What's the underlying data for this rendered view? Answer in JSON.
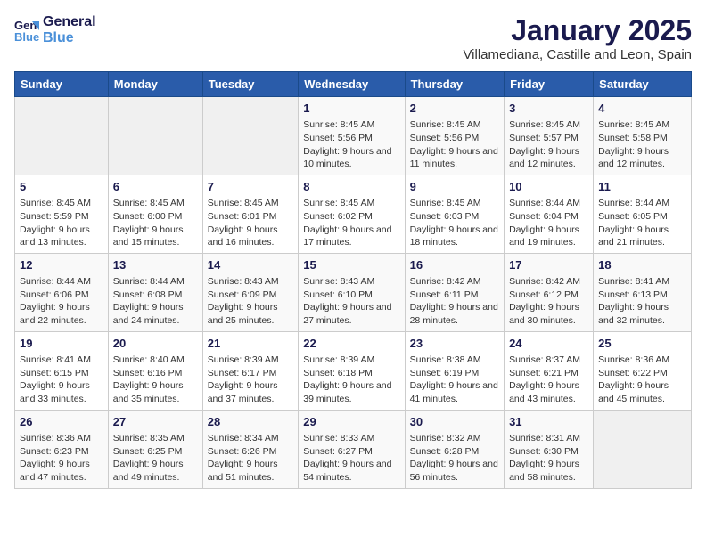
{
  "logo": {
    "line1": "General",
    "line2": "Blue"
  },
  "title": "January 2025",
  "subtitle": "Villamediana, Castille and Leon, Spain",
  "days_of_week": [
    "Sunday",
    "Monday",
    "Tuesday",
    "Wednesday",
    "Thursday",
    "Friday",
    "Saturday"
  ],
  "weeks": [
    [
      {
        "day": "",
        "info": ""
      },
      {
        "day": "",
        "info": ""
      },
      {
        "day": "",
        "info": ""
      },
      {
        "day": "1",
        "info": "Sunrise: 8:45 AM\nSunset: 5:56 PM\nDaylight: 9 hours and 10 minutes."
      },
      {
        "day": "2",
        "info": "Sunrise: 8:45 AM\nSunset: 5:56 PM\nDaylight: 9 hours and 11 minutes."
      },
      {
        "day": "3",
        "info": "Sunrise: 8:45 AM\nSunset: 5:57 PM\nDaylight: 9 hours and 12 minutes."
      },
      {
        "day": "4",
        "info": "Sunrise: 8:45 AM\nSunset: 5:58 PM\nDaylight: 9 hours and 12 minutes."
      }
    ],
    [
      {
        "day": "5",
        "info": "Sunrise: 8:45 AM\nSunset: 5:59 PM\nDaylight: 9 hours and 13 minutes."
      },
      {
        "day": "6",
        "info": "Sunrise: 8:45 AM\nSunset: 6:00 PM\nDaylight: 9 hours and 15 minutes."
      },
      {
        "day": "7",
        "info": "Sunrise: 8:45 AM\nSunset: 6:01 PM\nDaylight: 9 hours and 16 minutes."
      },
      {
        "day": "8",
        "info": "Sunrise: 8:45 AM\nSunset: 6:02 PM\nDaylight: 9 hours and 17 minutes."
      },
      {
        "day": "9",
        "info": "Sunrise: 8:45 AM\nSunset: 6:03 PM\nDaylight: 9 hours and 18 minutes."
      },
      {
        "day": "10",
        "info": "Sunrise: 8:44 AM\nSunset: 6:04 PM\nDaylight: 9 hours and 19 minutes."
      },
      {
        "day": "11",
        "info": "Sunrise: 8:44 AM\nSunset: 6:05 PM\nDaylight: 9 hours and 21 minutes."
      }
    ],
    [
      {
        "day": "12",
        "info": "Sunrise: 8:44 AM\nSunset: 6:06 PM\nDaylight: 9 hours and 22 minutes."
      },
      {
        "day": "13",
        "info": "Sunrise: 8:44 AM\nSunset: 6:08 PM\nDaylight: 9 hours and 24 minutes."
      },
      {
        "day": "14",
        "info": "Sunrise: 8:43 AM\nSunset: 6:09 PM\nDaylight: 9 hours and 25 minutes."
      },
      {
        "day": "15",
        "info": "Sunrise: 8:43 AM\nSunset: 6:10 PM\nDaylight: 9 hours and 27 minutes."
      },
      {
        "day": "16",
        "info": "Sunrise: 8:42 AM\nSunset: 6:11 PM\nDaylight: 9 hours and 28 minutes."
      },
      {
        "day": "17",
        "info": "Sunrise: 8:42 AM\nSunset: 6:12 PM\nDaylight: 9 hours and 30 minutes."
      },
      {
        "day": "18",
        "info": "Sunrise: 8:41 AM\nSunset: 6:13 PM\nDaylight: 9 hours and 32 minutes."
      }
    ],
    [
      {
        "day": "19",
        "info": "Sunrise: 8:41 AM\nSunset: 6:15 PM\nDaylight: 9 hours and 33 minutes."
      },
      {
        "day": "20",
        "info": "Sunrise: 8:40 AM\nSunset: 6:16 PM\nDaylight: 9 hours and 35 minutes."
      },
      {
        "day": "21",
        "info": "Sunrise: 8:39 AM\nSunset: 6:17 PM\nDaylight: 9 hours and 37 minutes."
      },
      {
        "day": "22",
        "info": "Sunrise: 8:39 AM\nSunset: 6:18 PM\nDaylight: 9 hours and 39 minutes."
      },
      {
        "day": "23",
        "info": "Sunrise: 8:38 AM\nSunset: 6:19 PM\nDaylight: 9 hours and 41 minutes."
      },
      {
        "day": "24",
        "info": "Sunrise: 8:37 AM\nSunset: 6:21 PM\nDaylight: 9 hours and 43 minutes."
      },
      {
        "day": "25",
        "info": "Sunrise: 8:36 AM\nSunset: 6:22 PM\nDaylight: 9 hours and 45 minutes."
      }
    ],
    [
      {
        "day": "26",
        "info": "Sunrise: 8:36 AM\nSunset: 6:23 PM\nDaylight: 9 hours and 47 minutes."
      },
      {
        "day": "27",
        "info": "Sunrise: 8:35 AM\nSunset: 6:25 PM\nDaylight: 9 hours and 49 minutes."
      },
      {
        "day": "28",
        "info": "Sunrise: 8:34 AM\nSunset: 6:26 PM\nDaylight: 9 hours and 51 minutes."
      },
      {
        "day": "29",
        "info": "Sunrise: 8:33 AM\nSunset: 6:27 PM\nDaylight: 9 hours and 54 minutes."
      },
      {
        "day": "30",
        "info": "Sunrise: 8:32 AM\nSunset: 6:28 PM\nDaylight: 9 hours and 56 minutes."
      },
      {
        "day": "31",
        "info": "Sunrise: 8:31 AM\nSunset: 6:30 PM\nDaylight: 9 hours and 58 minutes."
      },
      {
        "day": "",
        "info": ""
      }
    ]
  ]
}
